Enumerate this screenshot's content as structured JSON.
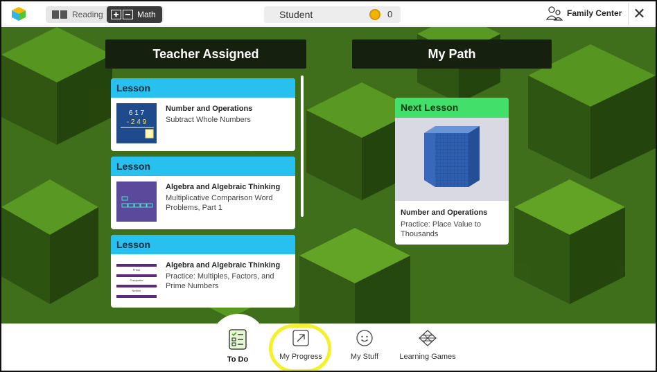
{
  "topbar": {
    "subjects": [
      {
        "label": "Reading",
        "active": false
      },
      {
        "label": "Math",
        "active": true
      }
    ],
    "student_name": "Student",
    "coins": "0",
    "family_center": "Family Center",
    "close_symbol": "✕"
  },
  "columns": {
    "left_title": "Teacher Assigned",
    "right_title": "My Path"
  },
  "assigned": [
    {
      "type": "Lesson",
      "title": "Number and Operations",
      "subtitle": "Subtract Whole Numbers"
    },
    {
      "type": "Lesson",
      "title": "Algebra and Algebraic Thinking",
      "subtitle": "Multiplicative Comparison Word Problems, Part 1"
    },
    {
      "type": "Lesson",
      "title": "Algebra and Algebraic Thinking",
      "subtitle": "Practice: Multiples, Factors, and Prime Numbers"
    }
  ],
  "thumb_text": {
    "subtract": {
      "top": "6 1 7",
      "bottom": "- 2 4 9"
    },
    "factors": {
      "prime": "Prime",
      "composite": "Composite",
      "neither": "Neither"
    }
  },
  "next_lesson": {
    "header": "Next Lesson",
    "title": "Number and Operations",
    "subtitle": "Practice: Place Value to Thousands"
  },
  "nav": [
    {
      "label": "To Do",
      "icon": "checklist-icon",
      "active": true
    },
    {
      "label": "My Progress",
      "icon": "progress-arrow-icon",
      "active": false
    },
    {
      "label": "My Stuff",
      "icon": "smiley-icon",
      "active": false
    },
    {
      "label": "Learning Games",
      "icon": "games-icon",
      "active": false
    }
  ],
  "colors": {
    "lesson_header": "#28c0ee",
    "next_header": "#42e06a",
    "highlight": "#f4f02a",
    "background_green": "#3f6f1a"
  }
}
